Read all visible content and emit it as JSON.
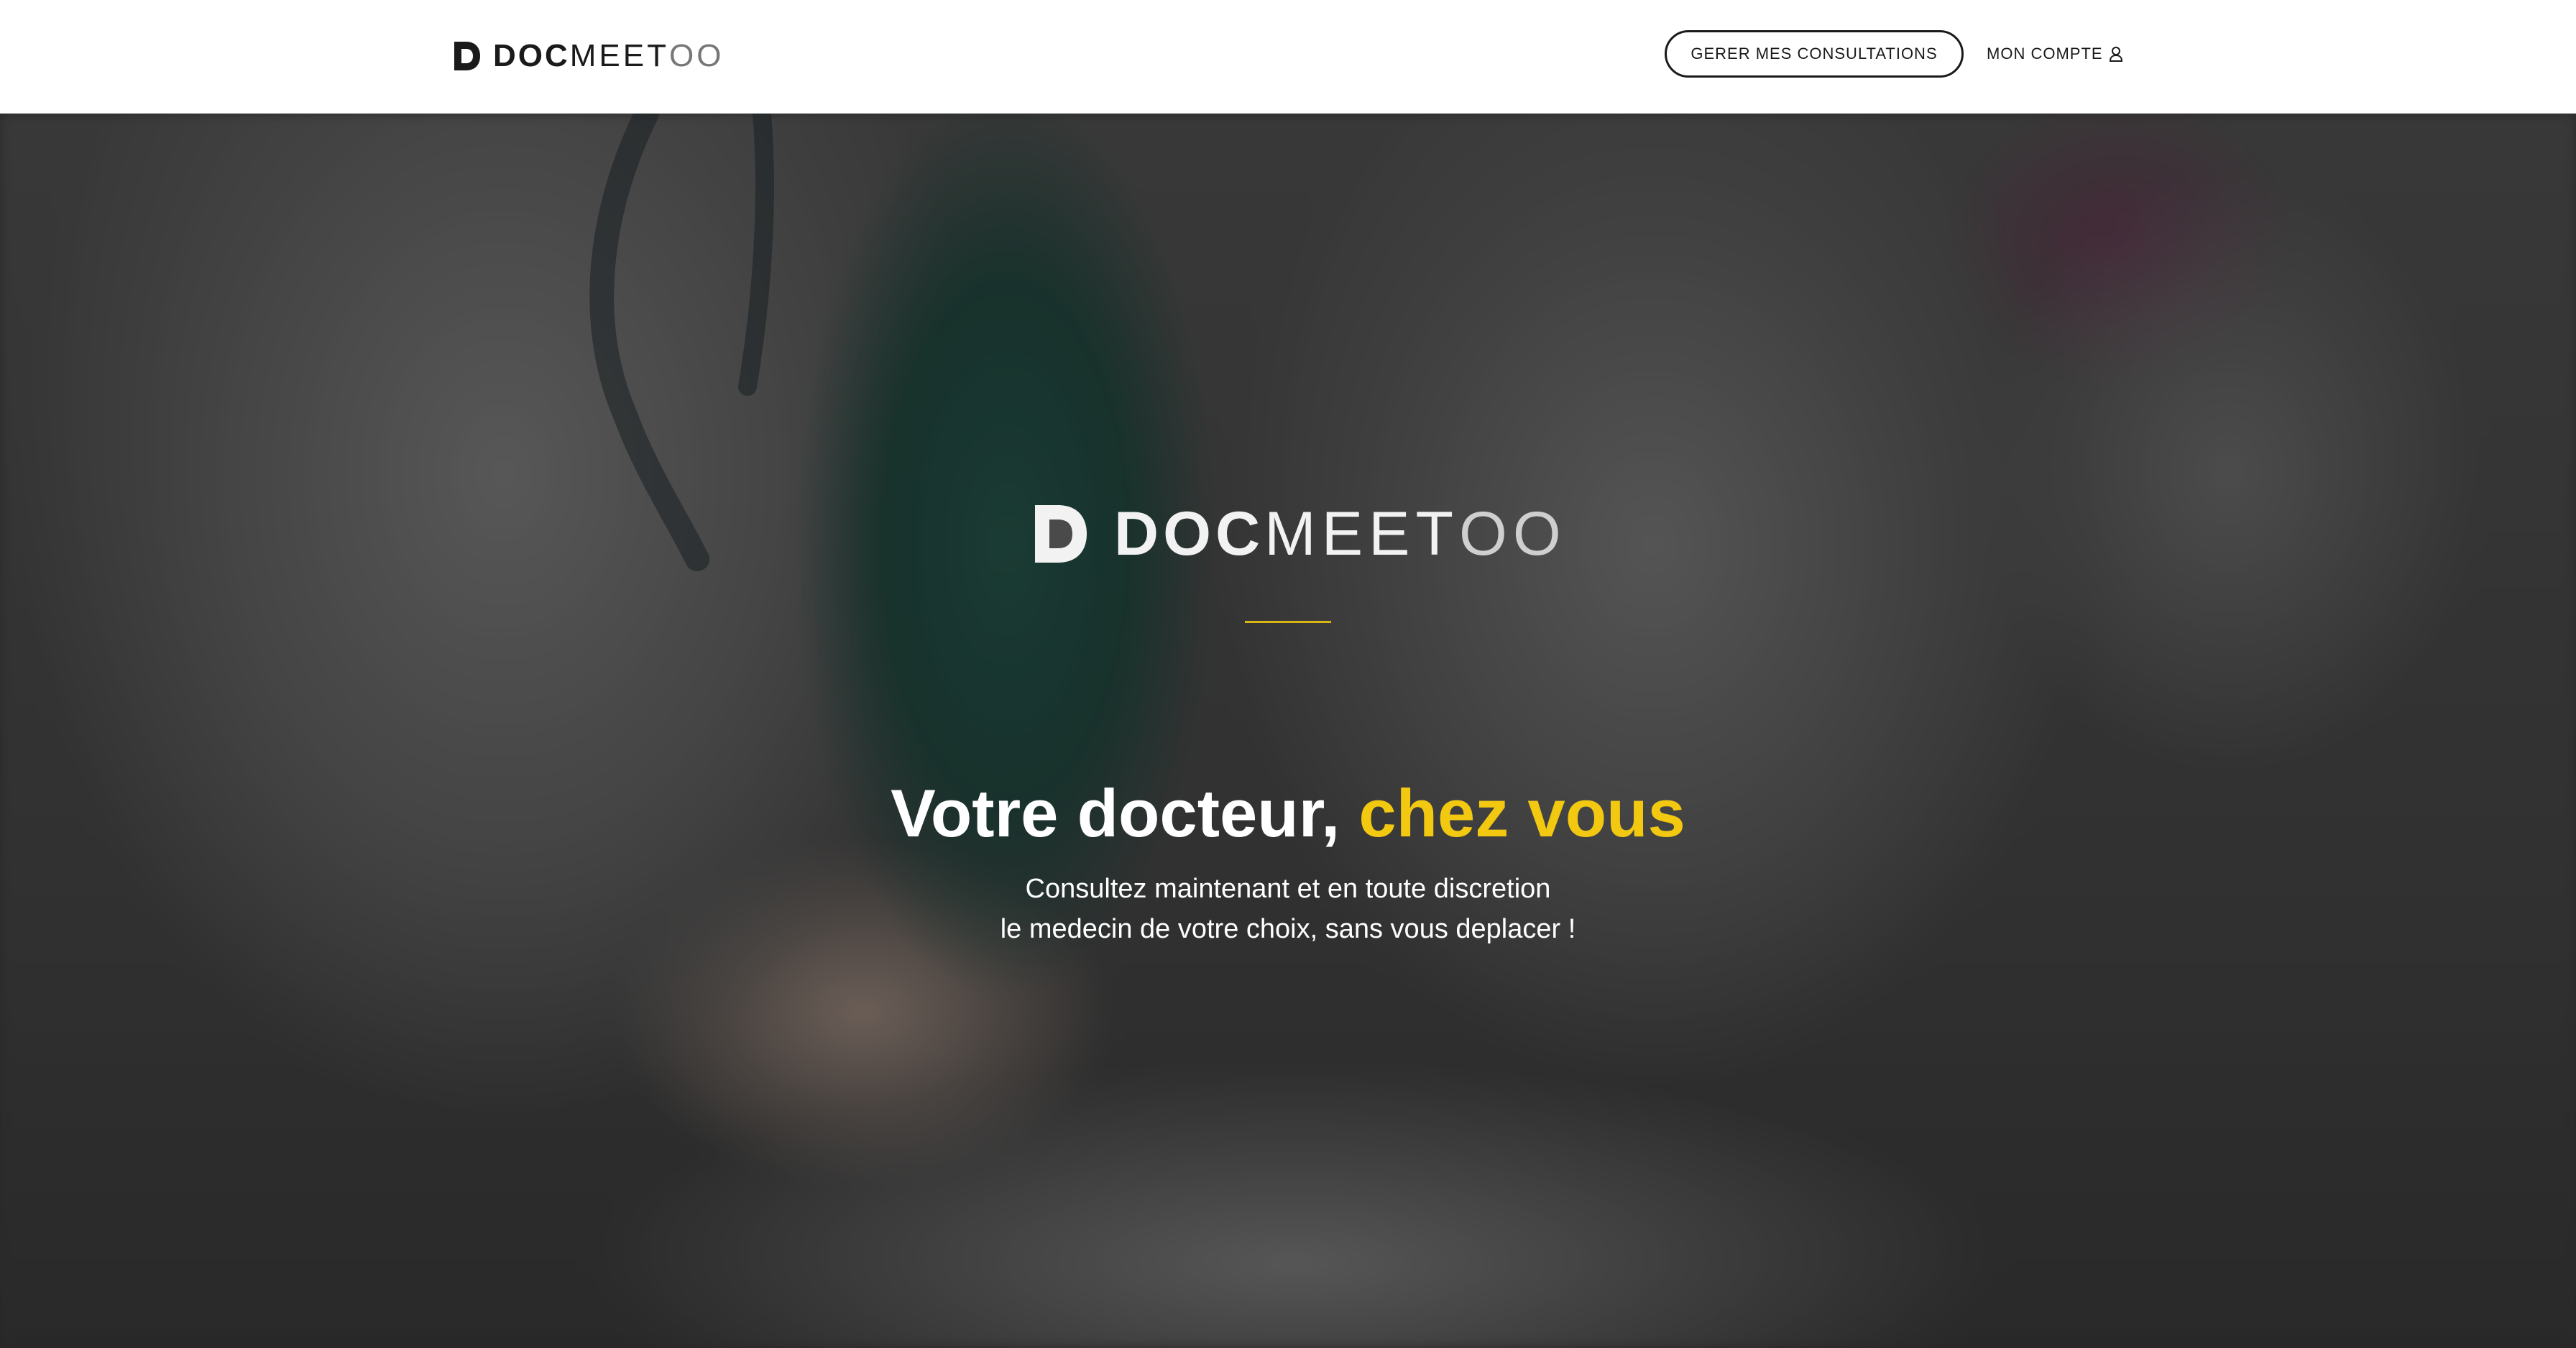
{
  "brand": {
    "name_doc": "DOC",
    "name_meet": "MEET",
    "name_oo": "OO"
  },
  "header": {
    "consult_button_label": "GERER MES CONSULTATIONS",
    "account_link_label": "MON COMPTE",
    "account_icon": "user-icon"
  },
  "hero": {
    "headline_main": "Votre docteur, ",
    "headline_accent": "chez vous",
    "subline_1": "Consultez maintenant et en toute discretion",
    "subline_2": "le medecin de votre choix, sans vous deplacer !"
  },
  "colors": {
    "accent": "#f2c811",
    "divider": "#d9b514",
    "text_dark": "#1a1a1a",
    "hero_text": "#ffffff"
  }
}
